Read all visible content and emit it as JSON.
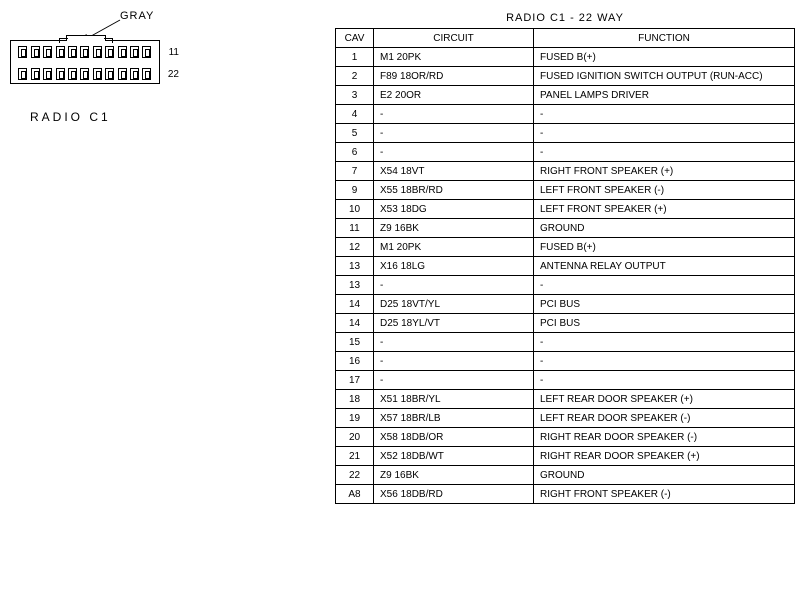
{
  "connector": {
    "gray_label": "GRAY",
    "pin_label_top": "11",
    "pin_label_bottom": "22",
    "caption": "RADIO C1"
  },
  "table": {
    "title": "RADIO C1 - 22 WAY",
    "headers": {
      "cav": "CAV",
      "circuit": "CIRCUIT",
      "function": "FUNCTION"
    },
    "rows": [
      {
        "cav": "1",
        "circuit": "M1 20PK",
        "function": "FUSED B(+)"
      },
      {
        "cav": "2",
        "circuit": "F89 18OR/RD",
        "function": "FUSED IGNITION SWITCH OUTPUT (RUN-ACC)"
      },
      {
        "cav": "3",
        "circuit": "E2 20OR",
        "function": "PANEL LAMPS DRIVER"
      },
      {
        "cav": "4",
        "circuit": "-",
        "function": "-"
      },
      {
        "cav": "5",
        "circuit": "-",
        "function": "-"
      },
      {
        "cav": "6",
        "circuit": "-",
        "function": "-"
      },
      {
        "cav": "7",
        "circuit": "X54 18VT",
        "function": "RIGHT FRONT SPEAKER (+)"
      },
      {
        "cav": "9",
        "circuit": "X55 18BR/RD",
        "function": "LEFT FRONT SPEAKER (-)"
      },
      {
        "cav": "10",
        "circuit": "X53 18DG",
        "function": "LEFT FRONT SPEAKER (+)"
      },
      {
        "cav": "11",
        "circuit": "Z9 16BK",
        "function": "GROUND"
      },
      {
        "cav": "12",
        "circuit": "M1 20PK",
        "function": "FUSED B(+)"
      },
      {
        "cav": "13",
        "circuit": "X16 18LG",
        "function": "ANTENNA RELAY OUTPUT"
      },
      {
        "cav": "13",
        "circuit": "-",
        "function": "-"
      },
      {
        "cav": "14",
        "circuit": "D25 18VT/YL",
        "function": "PCI BUS"
      },
      {
        "cav": "14",
        "circuit": "D25 18YL/VT",
        "function": "PCI BUS"
      },
      {
        "cav": "15",
        "circuit": "-",
        "function": "-"
      },
      {
        "cav": "16",
        "circuit": "-",
        "function": "-"
      },
      {
        "cav": "17",
        "circuit": "-",
        "function": "-"
      },
      {
        "cav": "18",
        "circuit": "X51 18BR/YL",
        "function": "LEFT REAR DOOR SPEAKER (+)"
      },
      {
        "cav": "19",
        "circuit": "X57 18BR/LB",
        "function": "LEFT REAR DOOR SPEAKER (-)"
      },
      {
        "cav": "20",
        "circuit": "X58 18DB/OR",
        "function": "RIGHT REAR DOOR SPEAKER (-)"
      },
      {
        "cav": "21",
        "circuit": "X52 18DB/WT",
        "function": "RIGHT REAR DOOR SPEAKER (+)"
      },
      {
        "cav": "22",
        "circuit": "Z9 16BK",
        "function": "GROUND"
      },
      {
        "cav": "A8",
        "circuit": "X56 18DB/RD",
        "function": "RIGHT FRONT SPEAKER (-)"
      }
    ]
  }
}
